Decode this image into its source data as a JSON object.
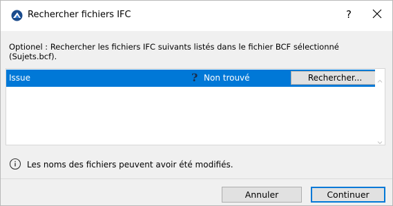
{
  "window": {
    "title": "Rechercher fichiers IFC",
    "help_label": "?",
    "icon": "archicad-app-icon"
  },
  "info": {
    "text": "Optionel : Rechercher les fichiers IFC suivants listés dans le fichier BCF sélectionné (Sujets.bcf)."
  },
  "list": {
    "rows": [
      {
        "name": "Issue",
        "status_icon": "question-mark-icon",
        "status": "Non trouvé",
        "action_label": "Rechercher..."
      }
    ]
  },
  "notice": {
    "icon": "info-circle-icon",
    "text": "Les noms des fichiers peuvent avoir été modifiés."
  },
  "buttons": {
    "cancel_label": "Annuler",
    "continue_label": "Continuer"
  },
  "colors": {
    "selection": "#0078d7",
    "focus_border": "#0078d7",
    "dialog_bg": "#f0f0f0"
  }
}
